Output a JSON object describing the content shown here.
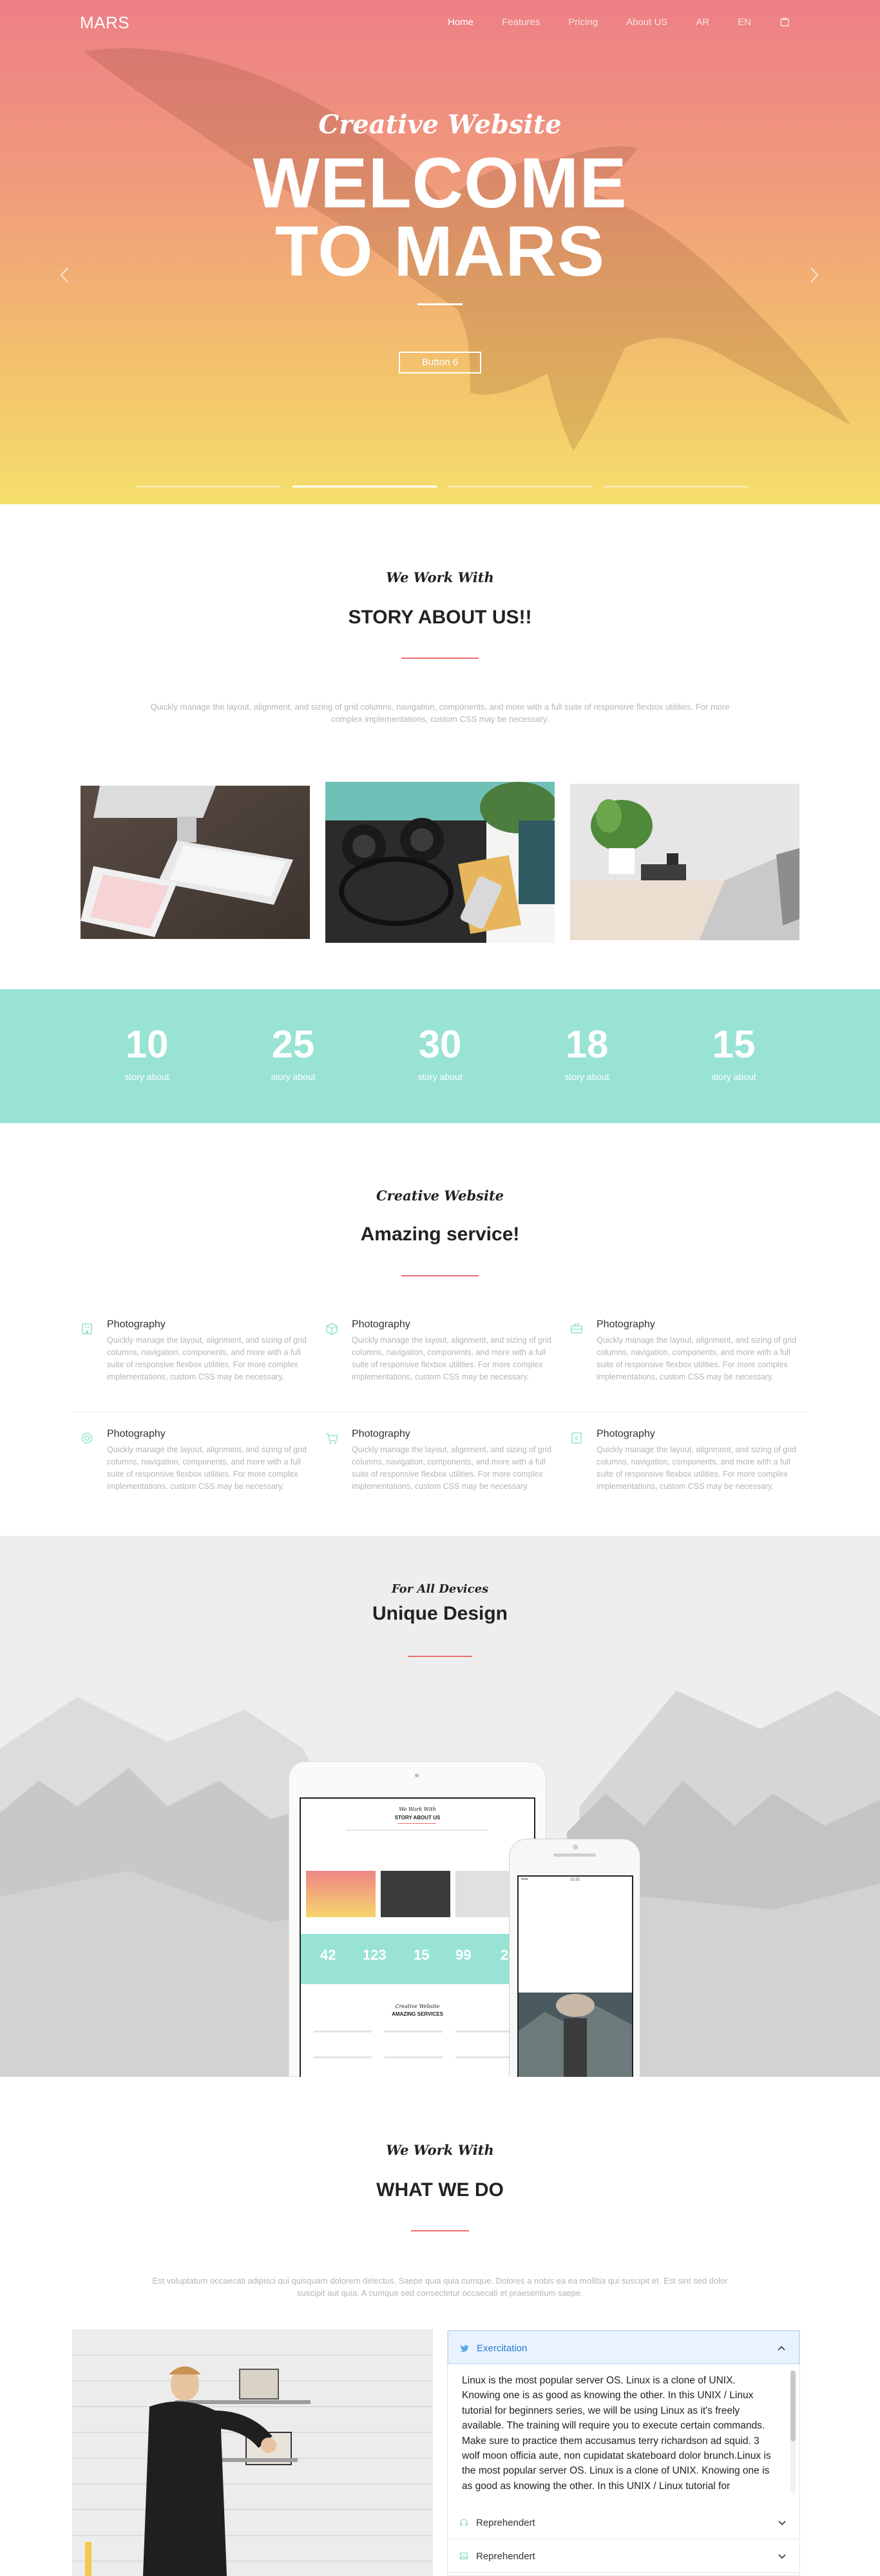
{
  "nav": {
    "logo": "MARS",
    "items": [
      "Home",
      "Features",
      "Pricing",
      "About US",
      "AR",
      "EN"
    ]
  },
  "hero": {
    "subtitle": "Creative Website",
    "title_line1": "WELCOME",
    "title_line2": "TO MARS",
    "button": "Button 6",
    "slide_index": 2,
    "slide_count": 4
  },
  "story": {
    "script": "We Work With",
    "title": "STORY ABOUT US!!",
    "text": "Quickly manage the layout, alignment, and sizing of grid columns, navigation, components, and more with a full suite of responsive flexbox utilities. For more complex implementations, custom CSS may be necessary."
  },
  "stats": [
    {
      "num": "10",
      "label": "story about"
    },
    {
      "num": "25",
      "label": "story about"
    },
    {
      "num": "30",
      "label": "story about"
    },
    {
      "num": "18",
      "label": "story about"
    },
    {
      "num": "15",
      "label": "story about"
    }
  ],
  "services": {
    "script": "Creative Website",
    "title": "Amazing service!",
    "items": [
      {
        "icon": "building-icon",
        "title": "Photography",
        "text": "Quickly manage the layout, alignment, and sizing of grid columns, navigation, components, and more with a full suite of responsive flexbox utilities. For more complex implementations, custom CSS may be necessary."
      },
      {
        "icon": "cube-icon",
        "title": "Photography",
        "text": "Quickly manage the layout, alignment, and sizing of grid columns, navigation, components, and more with a full suite of responsive flexbox utilities. For more complex implementations, custom CSS may be necessary."
      },
      {
        "icon": "briefcase-icon",
        "title": "Photography",
        "text": "Quickly manage the layout, alignment, and sizing of grid columns, navigation, components, and more with a full suite of responsive flexbox utilities. For more complex implementations, custom CSS may be necessary."
      },
      {
        "icon": "lifebuoy-icon",
        "title": "Photography",
        "text": "Quickly manage the layout, alignment, and sizing of grid columns, navigation, components, and more with a full suite of responsive flexbox utilities. For more complex implementations, custom CSS may be necessary."
      },
      {
        "icon": "cart-icon",
        "title": "Photography",
        "text": "Quickly manage the layout, alignment, and sizing of grid columns, navigation, components, and more with a full suite of responsive flexbox utilities. For more complex implementations, custom CSS may be necessary."
      },
      {
        "icon": "tag-icon",
        "title": "Photography",
        "text": "Quickly manage the layout, alignment, and sizing of grid columns, navigation, components, and more with a full suite of responsive flexbox utilities. For more complex implementations, custom CSS may be necessary."
      }
    ]
  },
  "devices": {
    "script": "For All Devices",
    "title": "Unique Design",
    "tablet": {
      "script": "We Work With",
      "title": "STORY ABOUT US",
      "stats": [
        "42",
        "123",
        "15",
        "99",
        "24"
      ],
      "section_script": "Creative Website",
      "section_title": "AMAZING SERVICES"
    },
    "phone": {
      "carrier": "•••••",
      "time": "12:21"
    }
  },
  "what": {
    "script": "We Work With",
    "title": "WHAT WE DO",
    "text": "Est voluptatum occaecati adipisci qui quisquam dolorem delectus. Saepe quia quia cumque. Dolores a nobis ea ea mollitia qui suscipit et. Est sint sed dolor suscipit aut quia. A cumque sed consectetur occaecati et praesentium saepe."
  },
  "accordion": {
    "open_label": "Exercitation",
    "body": "Linux is the most popular server OS. Linux is a clone of UNIX. Knowing one is as good as knowing the other. In this UNIX / Linux tutorial for beginners series, we will be using Linux as it's freely available. The training will require you to execute certain commands. Make sure to practice them accusamus terry richardson ad squid. 3 wolf moon officia aute, non cupidatat skateboard dolor brunch.Linux is the most popular server OS. Linux is a clone of UNIX. Knowing one is as good as knowing the other. In this UNIX / Linux tutorial for",
    "items": [
      "Reprehendert",
      "Reprehendert"
    ]
  },
  "colors": {
    "accent_teal": "#98e3d4",
    "accent_red": "#ef6e6e",
    "link_blue": "#2b7bd0"
  }
}
